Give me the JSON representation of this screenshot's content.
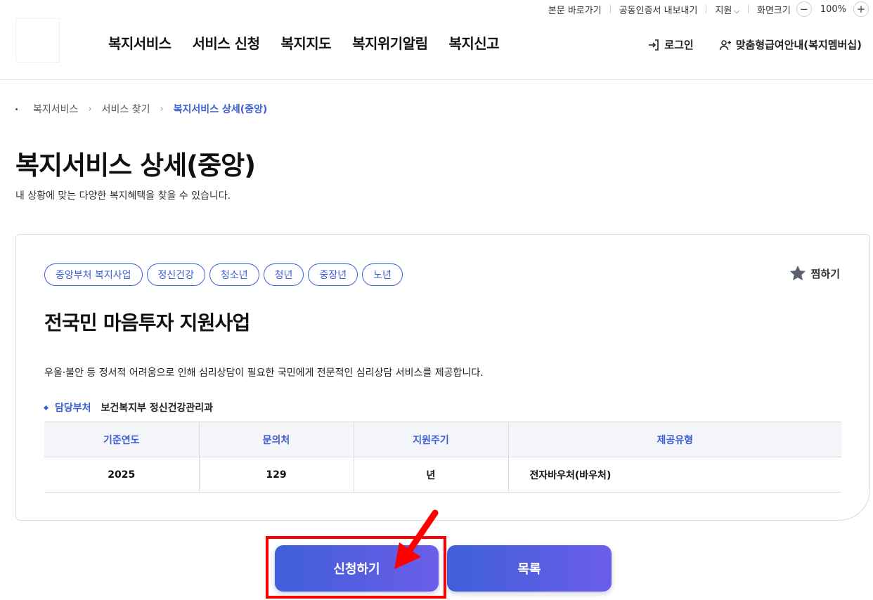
{
  "utility": {
    "skip_link": "본문 바로가기",
    "cert_export": "공동인증서 내보내기",
    "support": "지원",
    "zoom_label": "화면크기",
    "zoom_value": "100%",
    "zoom_minus": "−",
    "zoom_plus": "+"
  },
  "gnb": {
    "items": [
      {
        "label": "복지서비스"
      },
      {
        "label": "서비스 신청"
      },
      {
        "label": "복지지도"
      },
      {
        "label": "복지위기알림"
      },
      {
        "label": "복지신고"
      }
    ]
  },
  "header": {
    "login": "로그인",
    "membership": "맞춤형급여안내(복지멤버십)"
  },
  "breadcrumb": {
    "items": [
      "복지서비스",
      "서비스 찾기",
      "복지서비스 상세(중앙)"
    ]
  },
  "page": {
    "title": "복지서비스 상세(중앙)",
    "subtitle": "내 상황에 맞는 다양한 복지혜택을 찾을 수 있습니다."
  },
  "service": {
    "tags": [
      "중앙부처 복지사업",
      "정신건강",
      "청소년",
      "청년",
      "중장년",
      "노년"
    ],
    "favorite_label": "찜하기",
    "title": "전국민 마음투자 지원사업",
    "description": "우울·불안 등 정서적 어려움으로 인해 심리상담이 필요한 국민에게 전문적인 심리상담 서비스를 제공합니다.",
    "dept_label": "담당부처",
    "dept_value": "보건복지부 정신건강관리과",
    "table": {
      "headers": [
        "기준연도",
        "문의처",
        "지원주기",
        "제공유형"
      ],
      "row": [
        "2025",
        "129",
        "년",
        "전자바우처(바우처)"
      ]
    }
  },
  "actions": {
    "apply": "신청하기",
    "list": "목록"
  },
  "colors": {
    "accent": "#3d5fd6",
    "button_gradient_start": "#3f5fd8",
    "button_gradient_end": "#6a5ee8",
    "highlight": "#ff0000"
  }
}
